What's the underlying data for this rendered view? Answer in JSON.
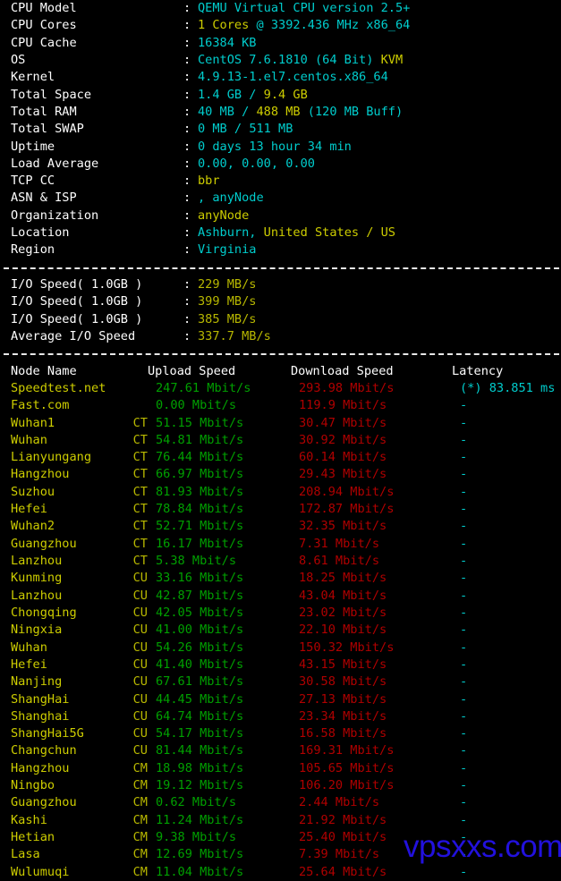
{
  "terminal": {
    "colors": {
      "background": "#000000",
      "label": "#ffffff",
      "cyan": "#00cdcd",
      "yellow": "#cdcd00",
      "green": "#00a000",
      "red": "#b00000",
      "olive": "#b8b800",
      "watermark": "#2211dd"
    }
  },
  "sysinfo": {
    "rows": [
      {
        "label": "CPU Model",
        "colon": ":",
        "parts": [
          {
            "t": "QEMU Virtual CPU version 2.5+",
            "c": "c-cyan"
          }
        ]
      },
      {
        "label": "CPU Cores",
        "colon": ":",
        "parts": [
          {
            "t": "1 Cores",
            "c": "c-yellow"
          },
          {
            "t": " @ 3392.436 MHz x86_64",
            "c": "c-cyan"
          }
        ]
      },
      {
        "label": "CPU Cache",
        "colon": ":",
        "parts": [
          {
            "t": "16384 KB",
            "c": "c-cyan"
          }
        ]
      },
      {
        "label": "OS",
        "colon": ":",
        "parts": [
          {
            "t": "CentOS 7.6.1810 (64 Bit)",
            "c": "c-cyan"
          },
          {
            "t": " KVM",
            "c": "c-yellow"
          }
        ]
      },
      {
        "label": "Kernel",
        "colon": ":",
        "parts": [
          {
            "t": "4.9.13-1.el7.centos.x86_64",
            "c": "c-cyan"
          }
        ]
      },
      {
        "label": "Total Space",
        "colon": ":",
        "parts": [
          {
            "t": "1.4 GB",
            "c": "c-cyan"
          },
          {
            "t": " / ",
            "c": "c-cyan"
          },
          {
            "t": "9.4 GB",
            "c": "c-yellow"
          }
        ]
      },
      {
        "label": "Total RAM",
        "colon": ":",
        "parts": [
          {
            "t": "40 MB",
            "c": "c-cyan"
          },
          {
            "t": " / ",
            "c": "c-cyan"
          },
          {
            "t": "488 MB",
            "c": "c-yellow"
          },
          {
            "t": " (120 MB Buff)",
            "c": "c-cyan"
          }
        ]
      },
      {
        "label": "Total SWAP",
        "colon": ":",
        "parts": [
          {
            "t": "0 MB",
            "c": "c-cyan"
          },
          {
            "t": " / ",
            "c": "c-cyan"
          },
          {
            "t": "511 MB",
            "c": "c-cyan"
          }
        ]
      },
      {
        "label": "Uptime",
        "colon": ":",
        "parts": [
          {
            "t": "0 days 13 hour 34 min",
            "c": "c-cyan"
          }
        ]
      },
      {
        "label": "Load Average",
        "colon": ":",
        "parts": [
          {
            "t": "0.00, 0.00, 0.00",
            "c": "c-cyan"
          }
        ]
      },
      {
        "label": "TCP CC",
        "colon": ":",
        "parts": [
          {
            "t": "bbr",
            "c": "c-yellow"
          }
        ]
      },
      {
        "label": "ASN & ISP",
        "colon": ":",
        "parts": [
          {
            "t": ", anyNode",
            "c": "c-cyan"
          }
        ]
      },
      {
        "label": "Organization",
        "colon": ":",
        "parts": [
          {
            "t": "anyNode",
            "c": "c-yellow"
          }
        ]
      },
      {
        "label": "Location",
        "colon": ":",
        "parts": [
          {
            "t": "Ashburn, ",
            "c": "c-cyan"
          },
          {
            "t": "United States / US",
            "c": "c-yellow"
          }
        ]
      },
      {
        "label": "Region",
        "colon": ":",
        "parts": [
          {
            "t": "Virginia",
            "c": "c-cyan"
          }
        ]
      }
    ]
  },
  "iospeed": {
    "rows": [
      {
        "label": "I/O Speed( 1.0GB )",
        "colon": ":",
        "value": "229 MB/s"
      },
      {
        "label": "I/O Speed( 1.0GB )",
        "colon": ":",
        "value": "399 MB/s"
      },
      {
        "label": "I/O Speed( 1.0GB )",
        "colon": ":",
        "value": "385 MB/s"
      },
      {
        "label": "Average I/O Speed",
        "colon": ":",
        "value": "337.7 MB/s"
      }
    ]
  },
  "speedtest": {
    "headers": {
      "node": "Node Name",
      "upload": "Upload Speed",
      "download": "Download Speed",
      "latency": "Latency"
    },
    "rows": [
      {
        "node": "Speedtest.net",
        "isp": "",
        "upload": "247.61 Mbit/s",
        "download": "293.98 Mbit/s",
        "latency": "(*) 83.851 ms"
      },
      {
        "node": "Fast.com",
        "isp": "",
        "upload": "0.00 Mbit/s",
        "download": "119.9 Mbit/s",
        "latency": "-"
      },
      {
        "node": "Wuhan1",
        "isp": "CT",
        "upload": "51.15 Mbit/s",
        "download": "30.47 Mbit/s",
        "latency": "-"
      },
      {
        "node": "Wuhan",
        "isp": "CT",
        "upload": "54.81 Mbit/s",
        "download": "30.92 Mbit/s",
        "latency": "-"
      },
      {
        "node": "Lianyungang",
        "isp": "CT",
        "upload": "76.44 Mbit/s",
        "download": "60.14 Mbit/s",
        "latency": "-"
      },
      {
        "node": "Hangzhou",
        "isp": "CT",
        "upload": "66.97 Mbit/s",
        "download": "29.43 Mbit/s",
        "latency": "-"
      },
      {
        "node": "Suzhou",
        "isp": "CT",
        "upload": "81.93 Mbit/s",
        "download": "208.94 Mbit/s",
        "latency": "-"
      },
      {
        "node": "Hefei",
        "isp": "CT",
        "upload": "78.84 Mbit/s",
        "download": "172.87 Mbit/s",
        "latency": "-"
      },
      {
        "node": "Wuhan2",
        "isp": "CT",
        "upload": "52.71 Mbit/s",
        "download": "32.35 Mbit/s",
        "latency": "-"
      },
      {
        "node": "Guangzhou",
        "isp": "CT",
        "upload": "16.17 Mbit/s",
        "download": "7.31 Mbit/s",
        "latency": "-"
      },
      {
        "node": "Lanzhou",
        "isp": "CT",
        "upload": "5.38 Mbit/s",
        "download": "8.61 Mbit/s",
        "latency": "-"
      },
      {
        "node": "Kunming",
        "isp": "CU",
        "upload": "33.16 Mbit/s",
        "download": "18.25 Mbit/s",
        "latency": "-"
      },
      {
        "node": "Lanzhou",
        "isp": "CU",
        "upload": "42.87 Mbit/s",
        "download": "43.04 Mbit/s",
        "latency": "-"
      },
      {
        "node": "Chongqing",
        "isp": "CU",
        "upload": "42.05 Mbit/s",
        "download": "23.02 Mbit/s",
        "latency": "-"
      },
      {
        "node": "Ningxia",
        "isp": "CU",
        "upload": "41.00 Mbit/s",
        "download": "22.10 Mbit/s",
        "latency": "-"
      },
      {
        "node": "Wuhan",
        "isp": "CU",
        "upload": "54.26 Mbit/s",
        "download": "150.32 Mbit/s",
        "latency": "-"
      },
      {
        "node": "Hefei",
        "isp": "CU",
        "upload": "41.40 Mbit/s",
        "download": "43.15 Mbit/s",
        "latency": "-"
      },
      {
        "node": "Nanjing",
        "isp": "CU",
        "upload": "67.61 Mbit/s",
        "download": "30.58 Mbit/s",
        "latency": "-"
      },
      {
        "node": "ShangHai",
        "isp": "CU",
        "upload": "44.45 Mbit/s",
        "download": "27.13 Mbit/s",
        "latency": "-"
      },
      {
        "node": "Shanghai",
        "isp": "CU",
        "upload": "64.74 Mbit/s",
        "download": "23.34 Mbit/s",
        "latency": "-"
      },
      {
        "node": "ShangHai5G",
        "isp": "CU",
        "upload": "54.17 Mbit/s",
        "download": "16.58 Mbit/s",
        "latency": "-"
      },
      {
        "node": "Changchun",
        "isp": "CU",
        "upload": "81.44 Mbit/s",
        "download": "169.31 Mbit/s",
        "latency": "-"
      },
      {
        "node": "Hangzhou",
        "isp": "CM",
        "upload": "18.98 Mbit/s",
        "download": "105.65 Mbit/s",
        "latency": "-"
      },
      {
        "node": "Ningbo",
        "isp": "CM",
        "upload": "19.12 Mbit/s",
        "download": "106.20 Mbit/s",
        "latency": "-"
      },
      {
        "node": "Guangzhou",
        "isp": "CM",
        "upload": "0.62 Mbit/s",
        "download": "2.44 Mbit/s",
        "latency": "-"
      },
      {
        "node": "Kashi",
        "isp": "CM",
        "upload": "11.24 Mbit/s",
        "download": "21.92 Mbit/s",
        "latency": "-"
      },
      {
        "node": "Hetian",
        "isp": "CM",
        "upload": "9.38 Mbit/s",
        "download": "25.40 Mbit/s",
        "latency": "-"
      },
      {
        "node": "Lasa",
        "isp": "CM",
        "upload": "12.69 Mbit/s",
        "download": "7.39 Mbit/s",
        "latency": "-"
      },
      {
        "node": "Wulumuqi",
        "isp": "CM",
        "upload": "11.04 Mbit/s",
        "download": "25.64 Mbit/s",
        "latency": "-"
      }
    ]
  },
  "watermark": {
    "text": "vpsxxs.com"
  }
}
